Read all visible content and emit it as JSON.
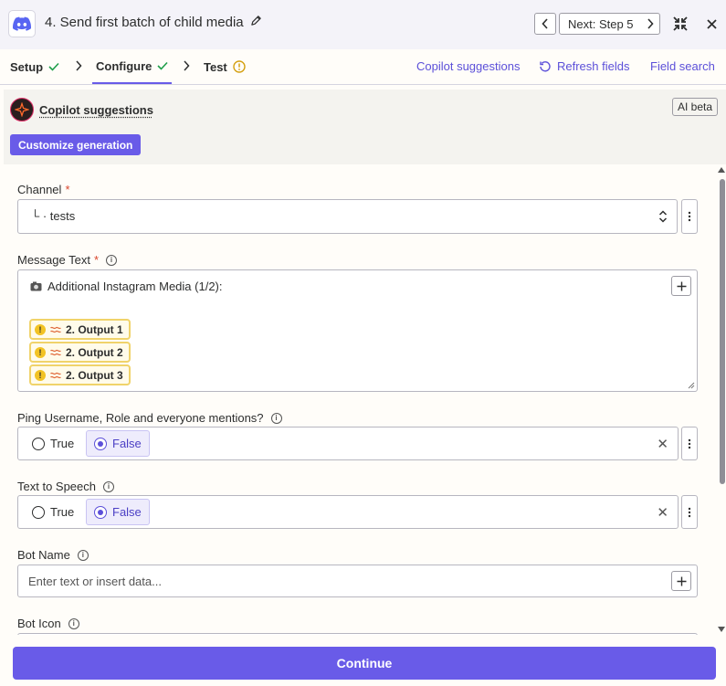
{
  "header": {
    "step_title": "4. Send first batch of child media",
    "next_label": "Next: Step 5"
  },
  "tabs": {
    "setup": "Setup",
    "configure": "Configure",
    "test": "Test",
    "copilot_link": "Copilot suggestions",
    "refresh_link": "Refresh fields",
    "field_search_link": "Field search"
  },
  "copilot": {
    "title": "Copilot suggestions",
    "badge": "AI beta",
    "customize_label": "Customize generation"
  },
  "form": {
    "channel": {
      "label": "Channel",
      "required": "*",
      "value": "└ · tests"
    },
    "message": {
      "label": "Message Text",
      "required": "*",
      "first_line": "Additional Instagram Media (1/2):",
      "pills": [
        "2. Output 1",
        "2. Output 2",
        "2. Output 3"
      ]
    },
    "ping": {
      "label": "Ping Username, Role and everyone mentions?",
      "options": [
        "True",
        "False"
      ],
      "selected": "False"
    },
    "tts": {
      "label": "Text to Speech",
      "options": [
        "True",
        "False"
      ],
      "selected": "False"
    },
    "bot_name": {
      "label": "Bot Name",
      "placeholder": "Enter text or insert data..."
    },
    "bot_icon": {
      "label": "Bot Icon"
    }
  },
  "footer": {
    "continue_label": "Continue"
  },
  "colors": {
    "accent": "#695be8",
    "link": "#5c50d9",
    "success": "#1f9e4a",
    "warning": "#d4a012",
    "required": "#d9462c"
  }
}
